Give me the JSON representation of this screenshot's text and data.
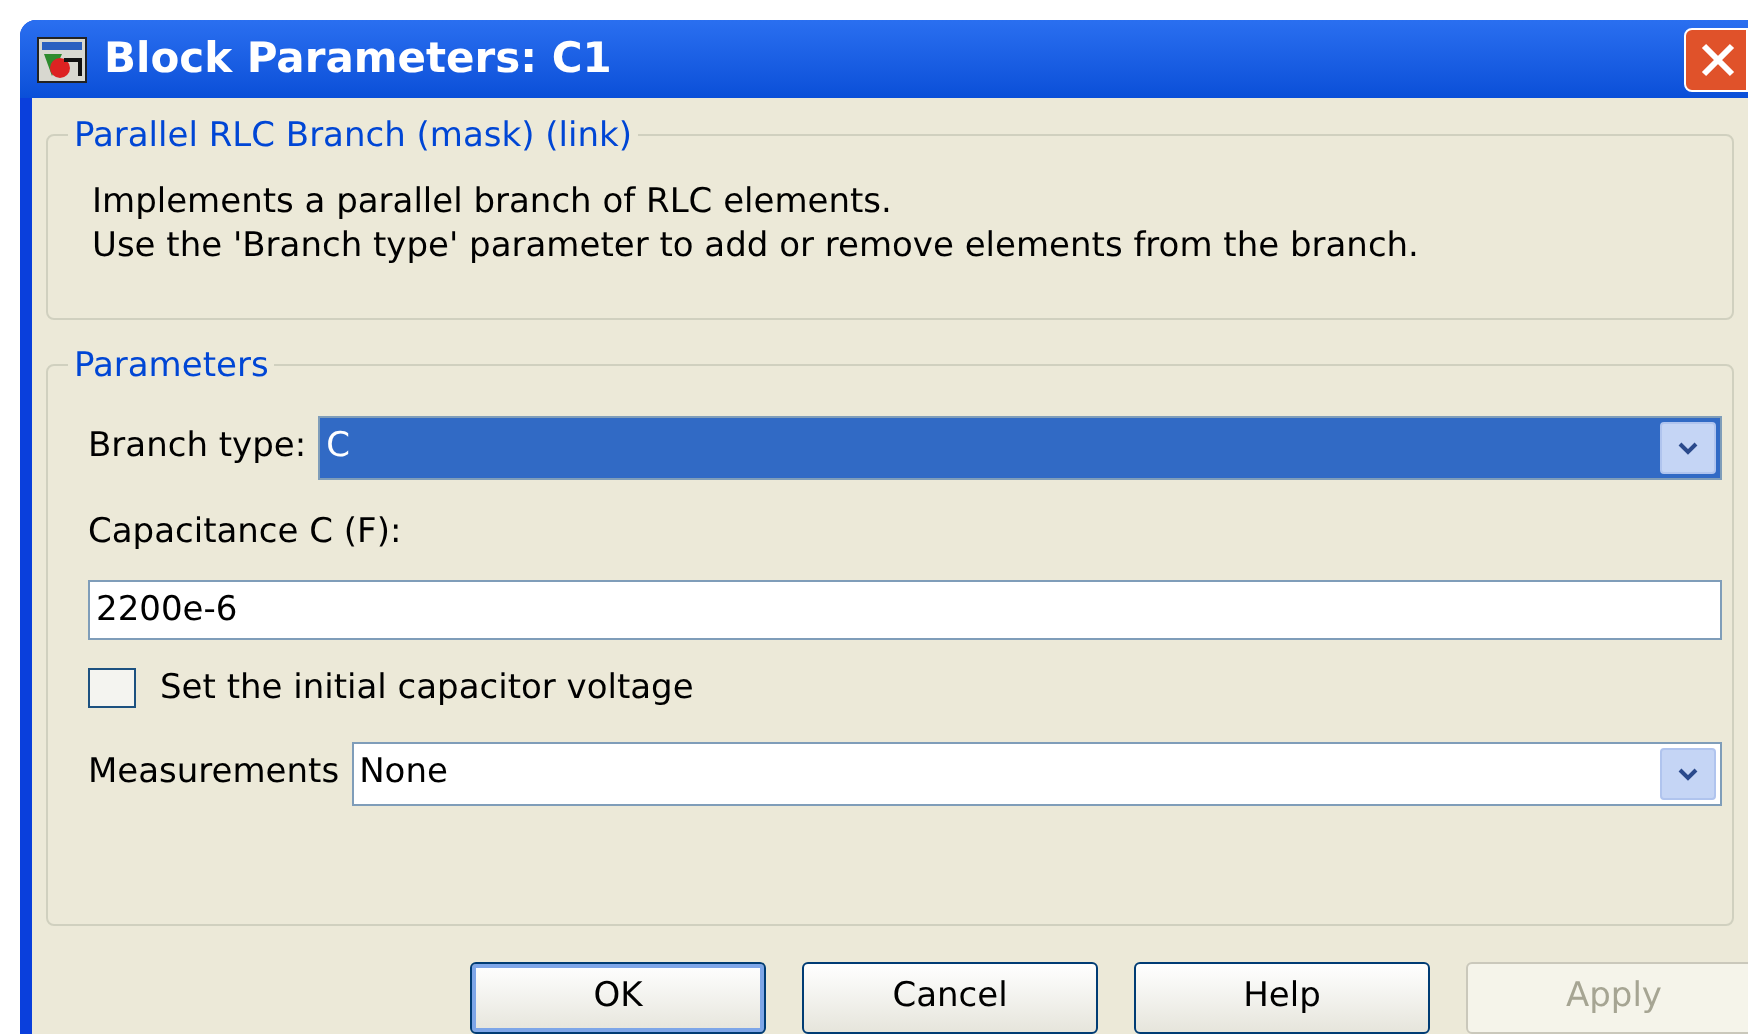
{
  "window": {
    "title": "Block Parameters: C1"
  },
  "description": {
    "title": "Parallel RLC Branch (mask) (link)",
    "lines": [
      "Implements a parallel branch of RLC elements.",
      "Use the 'Branch type' parameter to add or remove elements from the branch."
    ]
  },
  "parameters": {
    "title": "Parameters",
    "fields": [
      {
        "kind": "dropdown",
        "label": "Branch type:",
        "value": "C",
        "selected": true
      },
      {
        "kind": "text",
        "label": "Capacitance C (F):",
        "value": "2200e-6"
      },
      {
        "kind": "checkbox",
        "label": "Set the initial capacitor voltage",
        "checked": false
      },
      {
        "kind": "dropdown",
        "label": "Measurements",
        "value": "None",
        "selected": false
      }
    ]
  },
  "buttons": [
    {
      "label": "OK",
      "disabled": false,
      "default": true
    },
    {
      "label": "Cancel",
      "disabled": false,
      "default": false
    },
    {
      "label": "Help",
      "disabled": false,
      "default": false
    },
    {
      "label": "Apply",
      "disabled": true,
      "default": false
    }
  ]
}
